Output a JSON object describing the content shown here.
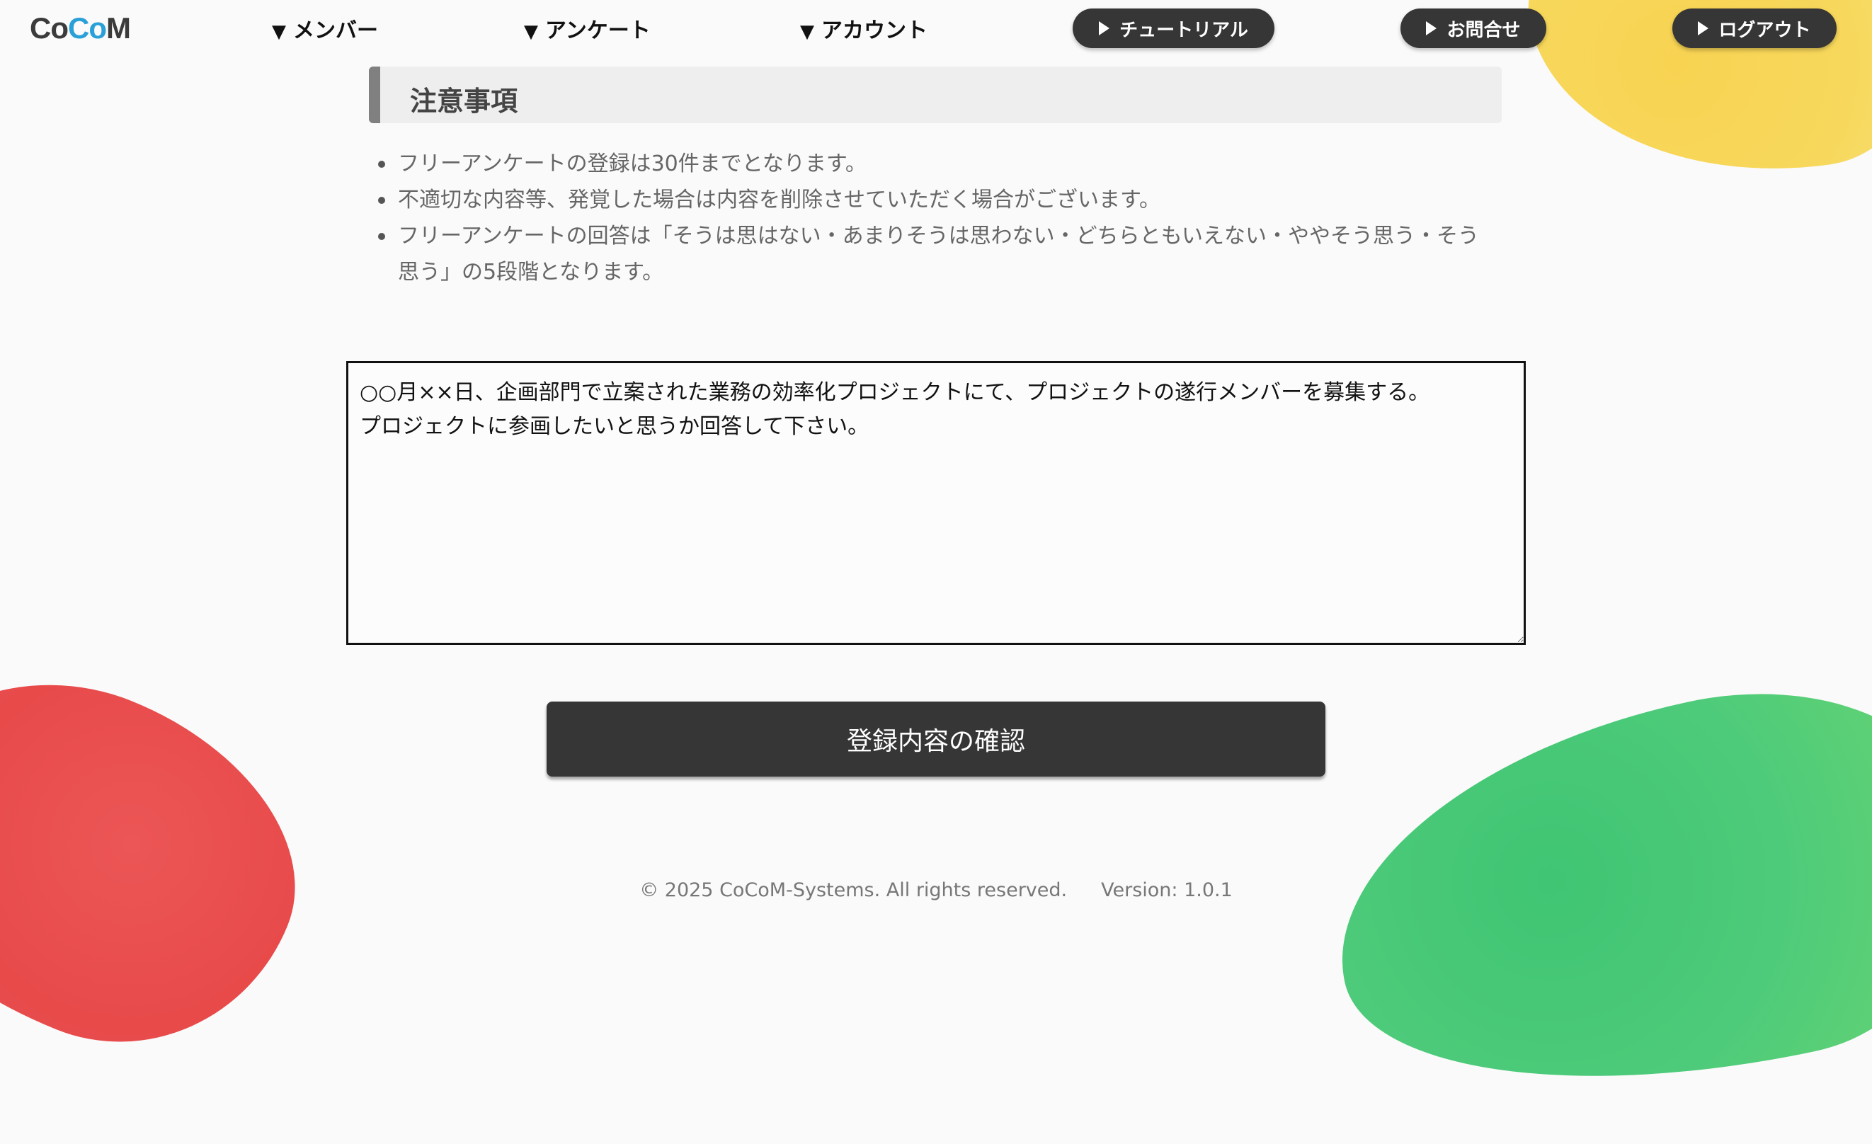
{
  "colors": {
    "accent_dark": "#363636",
    "logo_dark": "#3b3b3b",
    "logo_blue": "#2aa0d8",
    "blob_yellow": "#f8d352",
    "blob_red": "#e84a4a",
    "blob_green": "#4ecb7a"
  },
  "header": {
    "logo": {
      "pre": "Co",
      "mid": "Co",
      "post": "M"
    },
    "nav": [
      {
        "label": "メンバー",
        "icon": "triangle-down-icon"
      },
      {
        "label": "アンケート",
        "icon": "triangle-down-icon"
      },
      {
        "label": "アカウント",
        "icon": "triangle-down-icon"
      }
    ],
    "buttons": [
      {
        "label": "チュートリアル",
        "icon": "play-icon"
      },
      {
        "label": "お問合せ",
        "icon": "play-icon"
      },
      {
        "label": "ログアウト",
        "icon": "play-icon"
      }
    ]
  },
  "notes": {
    "heading": "注意事項",
    "items": [
      "フリーアンケートの登録は30件までとなります。",
      "不適切な内容等、発覚した場合は内容を削除させていただく場合がございます。",
      "フリーアンケートの回答は「そうは思はない・あまりそうは思わない・どちらともいえない・ややそう思う・そう思う」の5段階となります。"
    ]
  },
  "question": {
    "value": "○○月××日、企画部門で立案された業務の効率化プロジェクトにて、プロジェクトの遂行メンバーを募集する。\nプロジェクトに参画したいと思うか回答して下さい。"
  },
  "confirm_button": {
    "label": "登録内容の確認"
  },
  "footer": {
    "copyright": "© 2025 CoCoM-Systems. All rights reserved.",
    "version": "Version: 1.0.1"
  }
}
